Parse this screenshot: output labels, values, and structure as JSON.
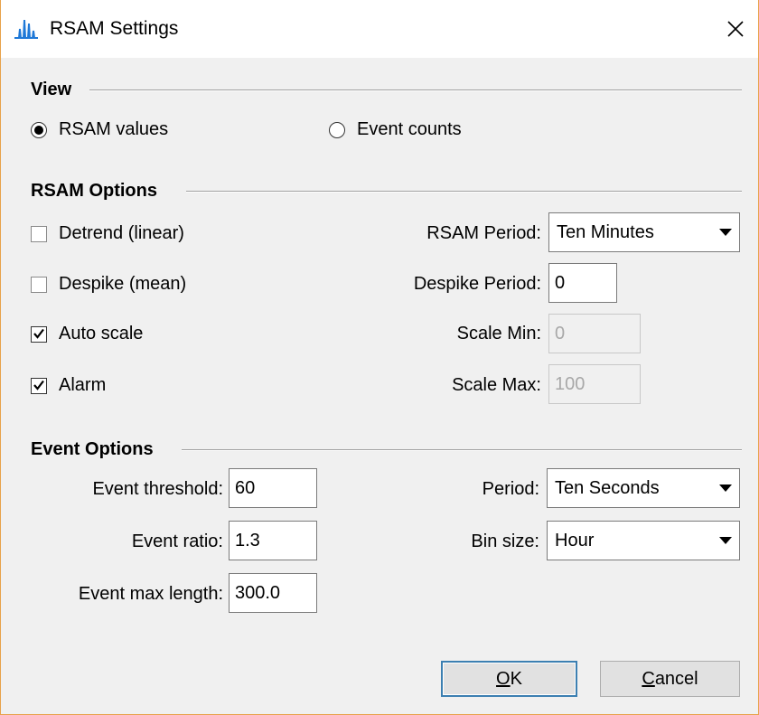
{
  "window": {
    "title": "RSAM Settings"
  },
  "view": {
    "section_title": "View",
    "options": [
      {
        "label": "RSAM values",
        "selected": true
      },
      {
        "label": "Event counts",
        "selected": false
      }
    ]
  },
  "rsam_options": {
    "section_title": "RSAM Options",
    "detrend": {
      "label": "Detrend (linear)",
      "checked": false
    },
    "despike": {
      "label": "Despike (mean)",
      "checked": false
    },
    "auto_scale": {
      "label": "Auto scale",
      "checked": true
    },
    "alarm": {
      "label": "Alarm",
      "checked": true
    },
    "rsam_period": {
      "label": "RSAM Period:",
      "value": "Ten Minutes"
    },
    "despike_period": {
      "label": "Despike Period:",
      "value": "0"
    },
    "scale_min": {
      "label": "Scale Min:",
      "value": "0",
      "disabled": true
    },
    "scale_max": {
      "label": "Scale Max:",
      "value": "100",
      "disabled": true
    }
  },
  "event_options": {
    "section_title": "Event Options",
    "event_threshold": {
      "label": "Event threshold:",
      "value": "60"
    },
    "event_ratio": {
      "label": "Event ratio:",
      "value": "1.3"
    },
    "event_max_length": {
      "label": "Event max length:",
      "value": "300.0"
    },
    "period": {
      "label": "Period:",
      "value": "Ten Seconds"
    },
    "bin_size": {
      "label": "Bin size:",
      "value": "Hour"
    }
  },
  "buttons": {
    "ok": {
      "mnemonic": "O",
      "rest": "K"
    },
    "cancel": {
      "mnemonic": "C",
      "rest": "ancel"
    }
  },
  "colors": {
    "accent": "#3c7fb1",
    "window_border": "#e8a24a",
    "icon": "#1e78d7"
  }
}
